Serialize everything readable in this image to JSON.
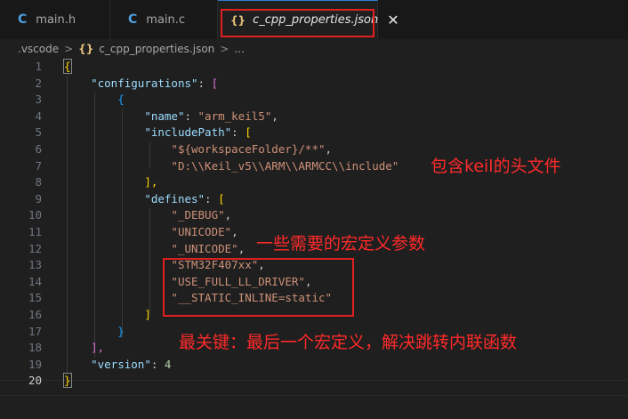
{
  "tabs": [
    {
      "icon": "C",
      "label": "main.h"
    },
    {
      "icon": "C",
      "label": "main.c"
    },
    {
      "icon": "{}",
      "label": "c_cpp_properties.json",
      "close": "✕"
    }
  ],
  "breadcrumb": {
    "folder": ".vscode",
    "sep": ">",
    "icon": "{}",
    "file": "c_cpp_properties.json",
    "more": "..."
  },
  "lines": [
    {
      "n": "1",
      "tokens": [
        {
          "t": "{",
          "c": "b1"
        }
      ]
    },
    {
      "n": "2",
      "tokens": [
        {
          "t": "    "
        },
        {
          "t": "\"configurations\"",
          "c": "k"
        },
        {
          "t": ": ",
          "c": "p"
        },
        {
          "t": "[",
          "c": "b2"
        }
      ]
    },
    {
      "n": "3",
      "tokens": [
        {
          "t": "        "
        },
        {
          "t": "{",
          "c": "b3"
        }
      ]
    },
    {
      "n": "4",
      "tokens": [
        {
          "t": "            "
        },
        {
          "t": "\"name\"",
          "c": "k"
        },
        {
          "t": ": ",
          "c": "p"
        },
        {
          "t": "\"arm_keil5\"",
          "c": "s"
        },
        {
          "t": ",",
          "c": "p"
        }
      ]
    },
    {
      "n": "5",
      "tokens": [
        {
          "t": "            "
        },
        {
          "t": "\"includePath\"",
          "c": "k"
        },
        {
          "t": ": ",
          "c": "p"
        },
        {
          "t": "[",
          "c": "b1"
        }
      ]
    },
    {
      "n": "6",
      "tokens": [
        {
          "t": "                "
        },
        {
          "t": "\"${workspaceFolder}/**\"",
          "c": "s"
        },
        {
          "t": ",",
          "c": "p"
        }
      ]
    },
    {
      "n": "7",
      "tokens": [
        {
          "t": "                "
        },
        {
          "t": "\"D:\\\\Keil_v5\\\\ARM\\\\ARMCC\\\\include\"",
          "c": "s"
        }
      ]
    },
    {
      "n": "8",
      "tokens": [
        {
          "t": "            "
        },
        {
          "t": "],",
          "c": "b1"
        }
      ]
    },
    {
      "n": "9",
      "tokens": [
        {
          "t": "            "
        },
        {
          "t": "\"defines\"",
          "c": "k"
        },
        {
          "t": ": ",
          "c": "p"
        },
        {
          "t": "[",
          "c": "b1"
        }
      ]
    },
    {
      "n": "10",
      "tokens": [
        {
          "t": "                "
        },
        {
          "t": "\"_DEBUG\"",
          "c": "s"
        },
        {
          "t": ",",
          "c": "p"
        }
      ]
    },
    {
      "n": "11",
      "tokens": [
        {
          "t": "                "
        },
        {
          "t": "\"UNICODE\"",
          "c": "s"
        },
        {
          "t": ",",
          "c": "p"
        }
      ]
    },
    {
      "n": "12",
      "tokens": [
        {
          "t": "                "
        },
        {
          "t": "\"_UNICODE\"",
          "c": "s"
        },
        {
          "t": ",",
          "c": "p"
        }
      ]
    },
    {
      "n": "13",
      "tokens": [
        {
          "t": "                "
        },
        {
          "t": "\"STM32F407xx\"",
          "c": "s"
        },
        {
          "t": ",",
          "c": "p"
        }
      ]
    },
    {
      "n": "14",
      "tokens": [
        {
          "t": "                "
        },
        {
          "t": "\"USE_FULL_LL_DRIVER\"",
          "c": "s"
        },
        {
          "t": ",",
          "c": "p"
        }
      ]
    },
    {
      "n": "15",
      "tokens": [
        {
          "t": "                "
        },
        {
          "t": "\"__STATIC_INLINE=static\"",
          "c": "s"
        }
      ]
    },
    {
      "n": "16",
      "tokens": [
        {
          "t": "            "
        },
        {
          "t": "]",
          "c": "b1"
        }
      ]
    },
    {
      "n": "17",
      "tokens": [
        {
          "t": "        "
        },
        {
          "t": "}",
          "c": "b3"
        }
      ]
    },
    {
      "n": "18",
      "tokens": [
        {
          "t": "    "
        },
        {
          "t": "],",
          "c": "b2"
        }
      ]
    },
    {
      "n": "19",
      "tokens": [
        {
          "t": "    "
        },
        {
          "t": "\"version\"",
          "c": "k"
        },
        {
          "t": ": ",
          "c": "p"
        },
        {
          "t": "4",
          "c": "n"
        }
      ]
    },
    {
      "n": "20",
      "tokens": [
        {
          "t": "}",
          "c": "b1"
        }
      ]
    }
  ],
  "annotations": {
    "include_note": "包含keil的头文件",
    "defines_note": "一些需要的宏定义参数",
    "key_note": "最关键：最后一个宏定义，解决跳转内联函数"
  }
}
